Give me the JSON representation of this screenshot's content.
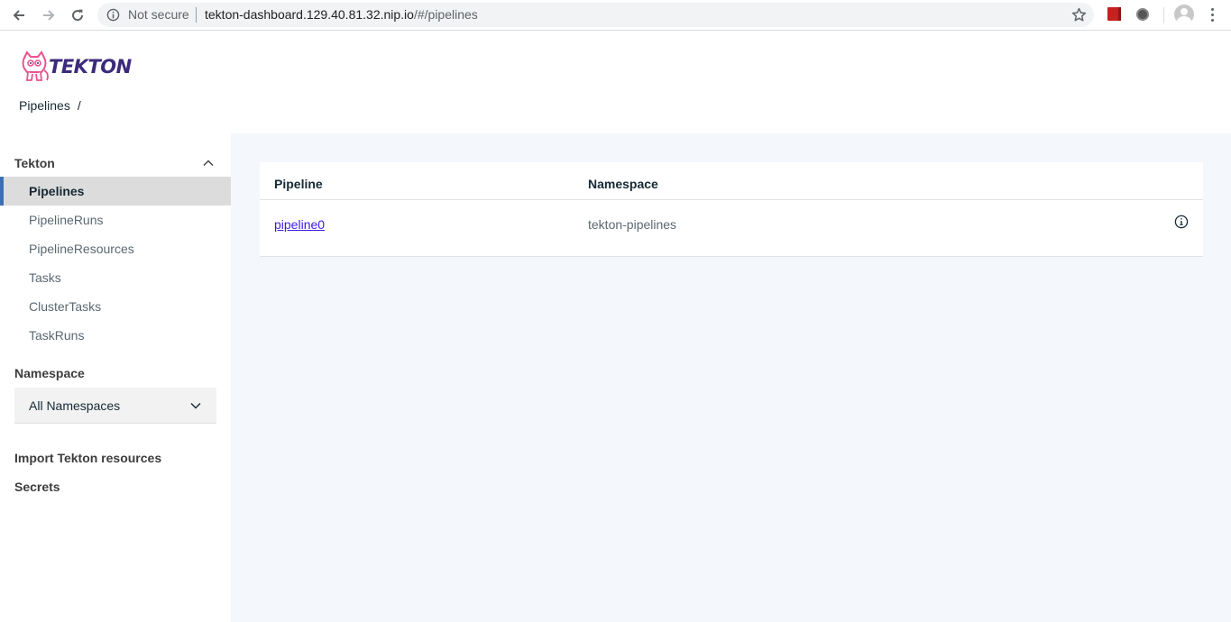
{
  "browser": {
    "security_label": "Not secure",
    "url_host": "tekton-dashboard.129.40.81.32.nip.io",
    "url_path": "/#/pipelines"
  },
  "header": {
    "logo_text": "TEKTON",
    "breadcrumb": {
      "current": "Pipelines",
      "separator": "/"
    }
  },
  "sidebar": {
    "group_title": "Tekton",
    "items": [
      {
        "label": "Pipelines",
        "active": true
      },
      {
        "label": "PipelineRuns",
        "active": false
      },
      {
        "label": "PipelineResources",
        "active": false
      },
      {
        "label": "Tasks",
        "active": false
      },
      {
        "label": "ClusterTasks",
        "active": false
      },
      {
        "label": "TaskRuns",
        "active": false
      }
    ],
    "namespace_title": "Namespace",
    "namespace_selected": "All Namespaces",
    "import_label": "Import Tekton resources",
    "secrets_label": "Secrets"
  },
  "table": {
    "columns": [
      "Pipeline",
      "Namespace"
    ],
    "rows": [
      {
        "pipeline": "pipeline0",
        "namespace": "tekton-pipelines"
      }
    ]
  },
  "colors": {
    "sidebar_active_border": "#3d70b2",
    "main_background": "#f4f7fb",
    "link": "#3b1de0"
  }
}
